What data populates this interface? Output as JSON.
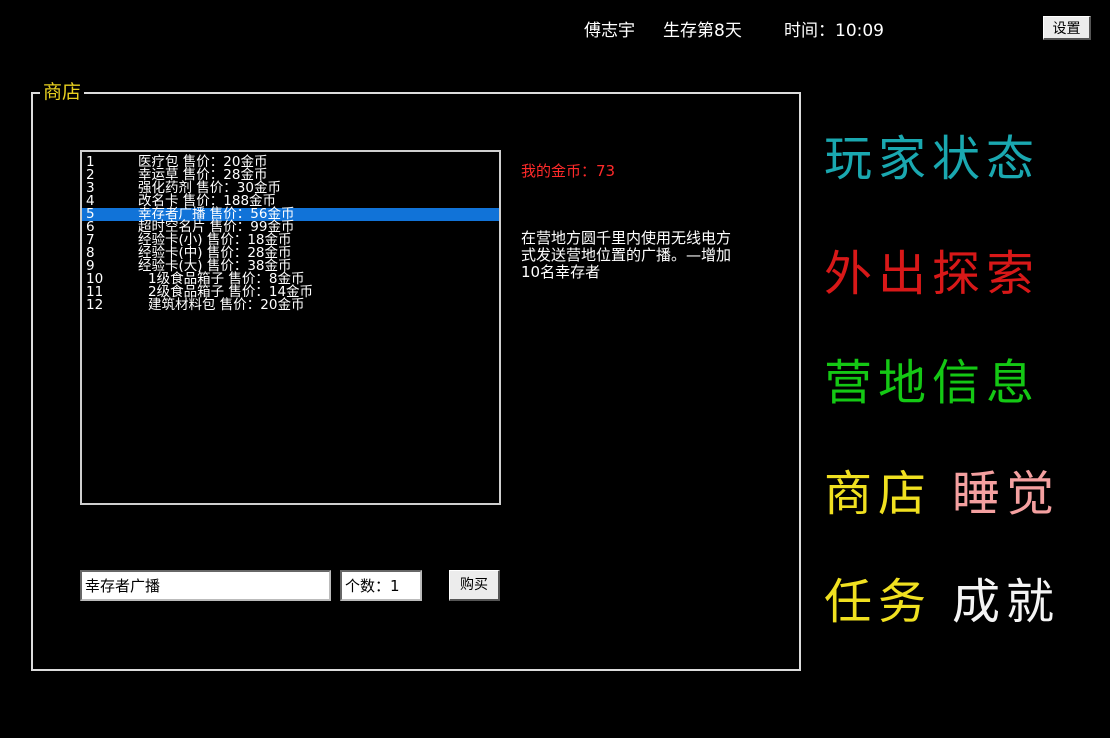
{
  "topbar": {
    "player_name": "傅志宇",
    "survival_day": "生存第8天",
    "time": "时间：10:09",
    "settings_label": "设置"
  },
  "shop": {
    "title": "商店",
    "items": [
      {
        "num": "1",
        "text": "医疗包    售价：20金币"
      },
      {
        "num": "2",
        "text": "幸运草    售价：28金币"
      },
      {
        "num": "3",
        "text": "强化药剂    售价：30金币"
      },
      {
        "num": "4",
        "text": "改名卡    售价：188金币"
      },
      {
        "num": "5",
        "text": "幸存者广播    售价：56金币"
      },
      {
        "num": "6",
        "text": "超时空名片    售价：99金币"
      },
      {
        "num": "7",
        "text": "经验卡(小)    售价：18金币"
      },
      {
        "num": "8",
        "text": "经验卡(中)    售价：28金币"
      },
      {
        "num": "9",
        "text": "经验卡(大)    售价：38金币"
      },
      {
        "num": "10",
        "text": "1级食品箱子    售价：8金币"
      },
      {
        "num": "11",
        "text": "2级食品箱子    售价：14金币"
      },
      {
        "num": "12",
        "text": "建筑材料包    售价：20金币"
      }
    ],
    "selected_index": 4,
    "coins": "我的金币：73",
    "description": "在营地方圆千里内使用无线电方式发送营地位置的广播。—增加10名幸存者",
    "item_name_value": "幸存者广播",
    "quantity_value": "个数：1",
    "buy_label": "购买"
  },
  "menu": {
    "player_status": {
      "label": "玩家状态",
      "color": "#1aa8b0"
    },
    "explore": {
      "label": "外出探索",
      "color": "#d81818"
    },
    "camp_info": {
      "label": "营地信息",
      "color": "#14c814"
    },
    "shop": {
      "label": "商店",
      "color": "#f0e020"
    },
    "sleep": {
      "label": "睡觉",
      "color": "#f4a0a0"
    },
    "tasks": {
      "label": "任务",
      "color": "#f0e020"
    },
    "achievements": {
      "label": "成就",
      "color": "#f4f4f4"
    }
  }
}
